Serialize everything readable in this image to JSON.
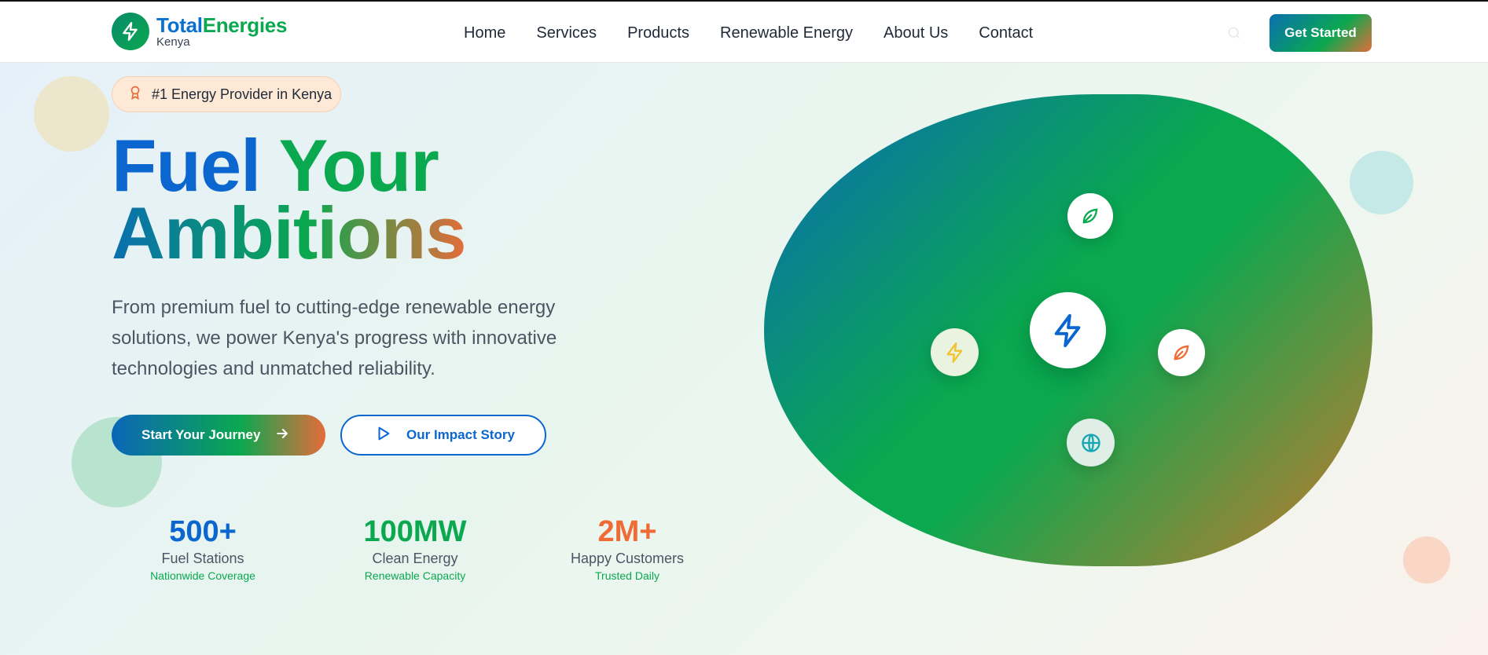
{
  "brand": {
    "name_part1": "Total",
    "name_part2": "Energies",
    "subtitle": "Kenya"
  },
  "nav": {
    "items": [
      "Home",
      "Services",
      "Products",
      "Renewable Energy",
      "About Us",
      "Contact"
    ],
    "cta": "Get Started"
  },
  "hero": {
    "badge": "#1 Energy Provider in Kenya",
    "headline_word1": "Fuel",
    "headline_word2": "Your",
    "headline_line2": "Ambitions",
    "description": "From premium fuel to cutting-edge renewable energy solutions, we power Kenya's progress with innovative technologies and unmatched reliability.",
    "primary_button": "Start Your Journey",
    "secondary_button": "Our Impact Story"
  },
  "stats": [
    {
      "value": "500+",
      "label": "Fuel Stations",
      "sub": "Nationwide Coverage",
      "color": "#0b66cf"
    },
    {
      "value": "100MW",
      "label": "Clean Energy",
      "sub": "Renewable Capacity",
      "color": "#0aa84f"
    },
    {
      "value": "2M+",
      "label": "Happy Customers",
      "sub": "Trusted Daily",
      "color": "#ef6a35"
    }
  ],
  "visual": {
    "icons": [
      "leaf-icon",
      "lightning-icon",
      "leaf-icon",
      "globe-icon",
      "lightning-icon"
    ]
  },
  "colors": {
    "blue": "#0b66cf",
    "green": "#0aa84f",
    "orange": "#e46c3a"
  }
}
